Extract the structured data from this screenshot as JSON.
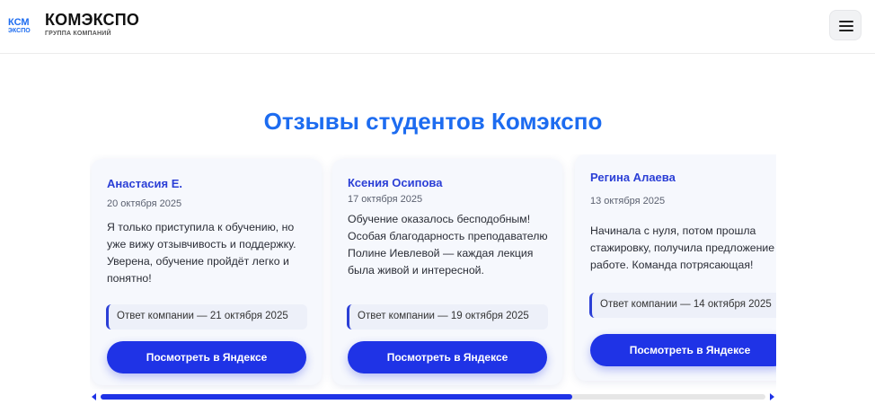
{
  "header": {
    "brand_name": "КОМЭКСПО",
    "brand_subtitle": "ГРУППА КОМПАНИЙ",
    "logo_icon": "komexpo-logo",
    "menu_icon": "hamburger-menu-icon"
  },
  "section": {
    "title": "Отзывы студентов Комэкспо"
  },
  "reviews": [
    {
      "author": "Анастасия Е.",
      "date": "20 октября 2025",
      "text": "Я только приступила к обучению, но уже вижу отзывчивость и поддержку. Уверена, обучение пройдёт легко и понятно!",
      "reply": "Ответ компании — 21 октября 2025",
      "button": "Посмотреть в Яндексе"
    },
    {
      "author": "Ксения Осипова",
      "date": "17 октября 2025",
      "text": "Обучение оказалось бесподобным! Особая благодарность преподавателю Полине Иевлевой — каждая лекция была живой и интересной.",
      "reply": "Ответ компании — 19 октября 2025",
      "button": "Посмотреть в Яндексе"
    },
    {
      "author": "Регина Алаева",
      "date": "13 октября 2025",
      "text": "Начинала с нуля, потом прошла стажировку, получила предложение о работе. Команда потрясающая!",
      "reply": "Ответ компании — 14 октября 2025",
      "button": "Посмотреть в Яндексе"
    }
  ],
  "scrollbar": {
    "position_fraction": 0.71,
    "accent_color": "#1f33e6"
  }
}
